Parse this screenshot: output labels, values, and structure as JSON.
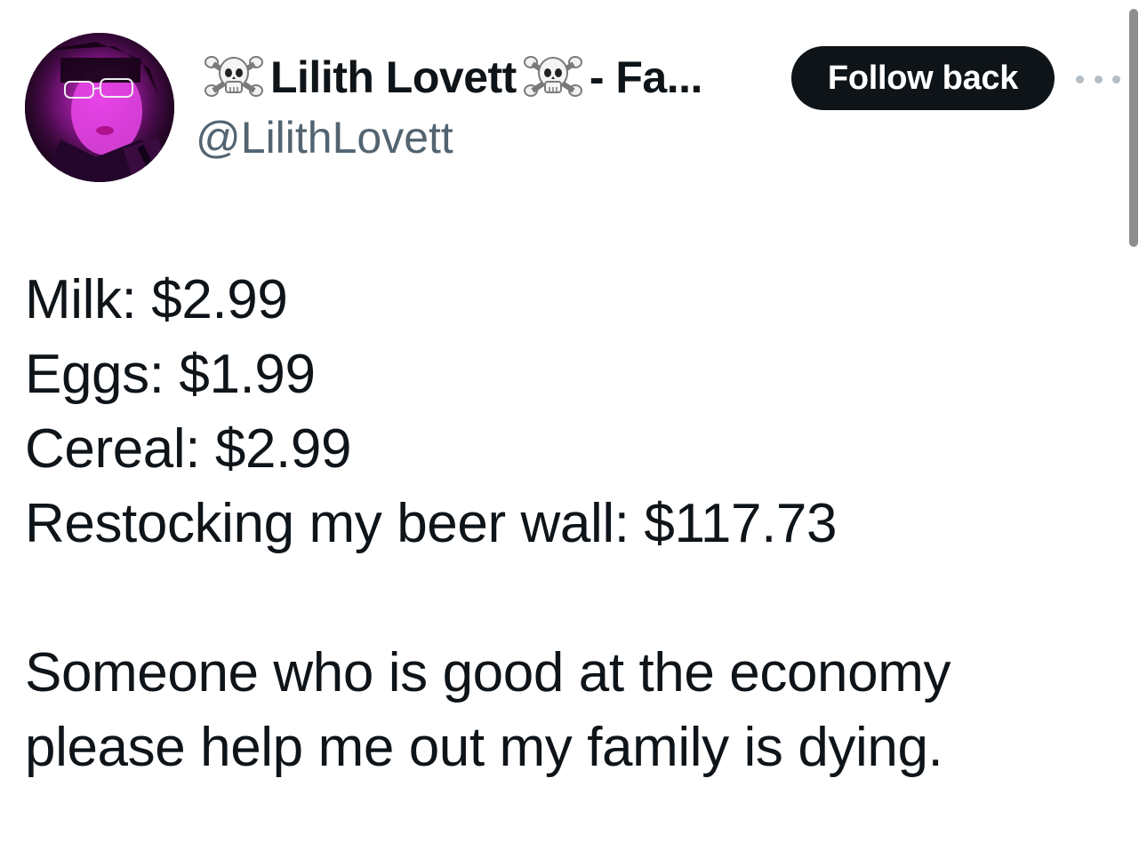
{
  "author": {
    "display_name_prefix_icon": "skull-and-crossbones-icon",
    "display_name": "Lilith Lovett",
    "display_name_suffix_icon": "skull-and-crossbones-icon",
    "display_name_tail": "- Fa...",
    "handle": "@LilithLovett",
    "avatar_alt": "profile picture"
  },
  "actions": {
    "follow_label": "Follow back",
    "more_icon": "more-horizontal-icon"
  },
  "tweet": {
    "lines": [
      "Milk: $2.99",
      "Eggs: $1.99",
      "Cereal: $2.99",
      "Restocking my beer wall: $117.73",
      "",
      "Someone who is good at the economy",
      "please help me out my family is dying."
    ]
  },
  "colors": {
    "text_primary": "#0f1419",
    "text_secondary": "#536471",
    "button_bg": "#0f1419",
    "button_text": "#ffffff",
    "avatar_accent": "#d41fd8"
  }
}
